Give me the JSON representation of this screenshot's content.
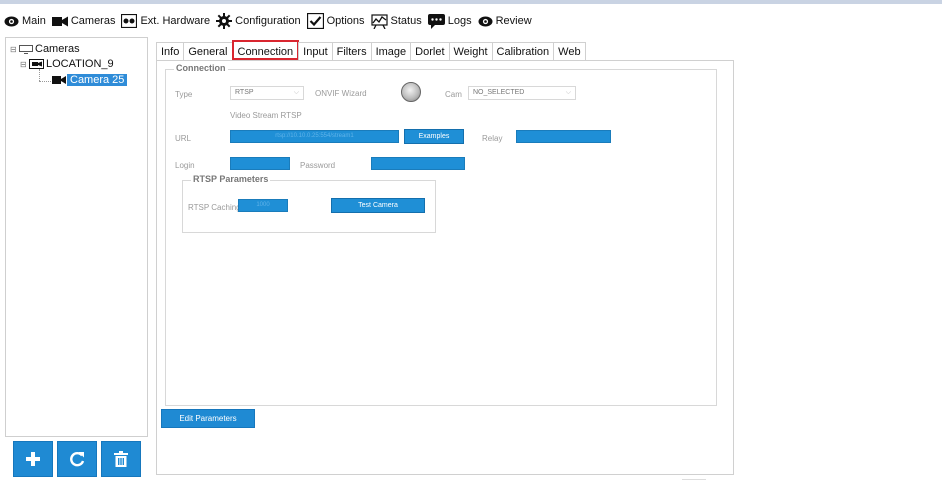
{
  "menu": [
    {
      "label": "Main",
      "icon": "eye-icon"
    },
    {
      "label": "Cameras",
      "icon": "video-camera-icon"
    },
    {
      "label": "Ext. Hardware",
      "icon": "hardware-icon"
    },
    {
      "label": "Configuration",
      "icon": "gear-icon"
    },
    {
      "label": "Options",
      "icon": "checkbox-icon"
    },
    {
      "label": "Status",
      "icon": "chart-icon"
    },
    {
      "label": "Logs",
      "icon": "chat-bubble-icon"
    },
    {
      "label": "Review",
      "icon": "eye-icon"
    }
  ],
  "tree": {
    "root": "Cameras",
    "location": "LOCATION_9",
    "camera": "Camera 25"
  },
  "tabs": [
    "Info",
    "General",
    "Connection",
    "Input",
    "Filters",
    "Image",
    "Dorlet",
    "Weight",
    "Calibration",
    "Web"
  ],
  "active_tab": "Connection",
  "connection": {
    "legend": "Connection",
    "type_label": "Type",
    "type_value": "RTSP",
    "onvif_label": "ONVIF Wizard",
    "cam_label": "Cam",
    "cam_value": "NO_SELECTED",
    "video_stream_label": "Video Stream RTSP",
    "url_label": "URL",
    "url_value": "rtsp://10.10.0.25:554/stream1",
    "examples_button": "Examples",
    "relay_label": "Relay",
    "login_label": "Login",
    "password_label": "Password"
  },
  "rtsp": {
    "legend": "RTSP Parameters",
    "caching_label": "RTSP Caching",
    "caching_value": "1000",
    "test_button": "Test Camera"
  },
  "edit_button": "Edit Parameters",
  "colors": {
    "accent": "#1f8ad3",
    "highlight": "#d9262f"
  }
}
